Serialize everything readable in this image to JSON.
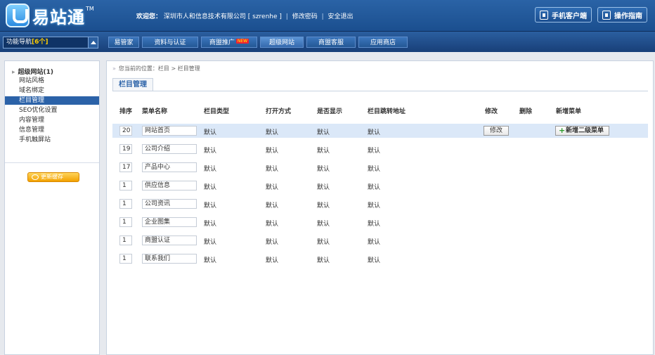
{
  "header": {
    "logo_text": "易站通",
    "logo_tm": "TM",
    "welcome_label": "欢迎您：",
    "company": "深圳市人和信息技术有限公司 [ szrenhe ]",
    "change_password": "修改密码",
    "logout": "安全退出",
    "mobile_client": "手机客户端",
    "guide": "操作指南"
  },
  "nav": {
    "func_label": "功能导航",
    "func_count": "[6个]",
    "tabs": [
      {
        "label": "易管家"
      },
      {
        "label": "资料与认证"
      },
      {
        "label": "商盟推广",
        "badge": "NEW"
      },
      {
        "label": "超级网站"
      },
      {
        "label": "商盟客服"
      },
      {
        "label": "应用商店"
      }
    ]
  },
  "sidebar": {
    "title": "超级网站(1)",
    "items": [
      {
        "label": "网站风格"
      },
      {
        "label": "域名绑定"
      },
      {
        "label": "栏目管理"
      },
      {
        "label": "SEO优化设置"
      },
      {
        "label": "内容管理"
      },
      {
        "label": "信息管理"
      },
      {
        "label": "手机触屏站"
      }
    ],
    "update_label": "更新缓存"
  },
  "main": {
    "breadcrumb": "您当前的位置：栏目 > 栏目管理",
    "page_title": "栏目管理",
    "columns": [
      "排序",
      "菜单名称",
      "栏目类型",
      "打开方式",
      "是否显示",
      "栏目跳转地址",
      "修改",
      "删除",
      "新增菜单"
    ],
    "rows": [
      {
        "order": "20",
        "name": "网站首页",
        "type": "默认",
        "open": "默认",
        "show": "默认",
        "jump": "默认"
      },
      {
        "order": "19",
        "name": "公司介绍",
        "type": "默认",
        "open": "默认",
        "show": "默认",
        "jump": "默认"
      },
      {
        "order": "17",
        "name": "产品中心",
        "type": "默认",
        "open": "默认",
        "show": "默认",
        "jump": "默认"
      },
      {
        "order": "1",
        "name": "供应信息",
        "type": "默认",
        "open": "默认",
        "show": "默认",
        "jump": "默认"
      },
      {
        "order": "1",
        "name": "公司资讯",
        "type": "默认",
        "open": "默认",
        "show": "默认",
        "jump": "默认"
      },
      {
        "order": "1",
        "name": "企业图集",
        "type": "默认",
        "open": "默认",
        "show": "默认",
        "jump": "默认"
      },
      {
        "order": "1",
        "name": "商盟认证",
        "type": "默认",
        "open": "默认",
        "show": "默认",
        "jump": "默认"
      },
      {
        "order": "1",
        "name": "联系我们",
        "type": "默认",
        "open": "默认",
        "show": "默认",
        "jump": "默认"
      }
    ],
    "edit_label": "修改",
    "add_label": "新增二级菜单"
  },
  "colors": {
    "header_blue": "#1b4f8f",
    "active_blue": "#2b62a8",
    "row_highlight": "#dbe8f8",
    "update_orange": "#f2a100"
  }
}
